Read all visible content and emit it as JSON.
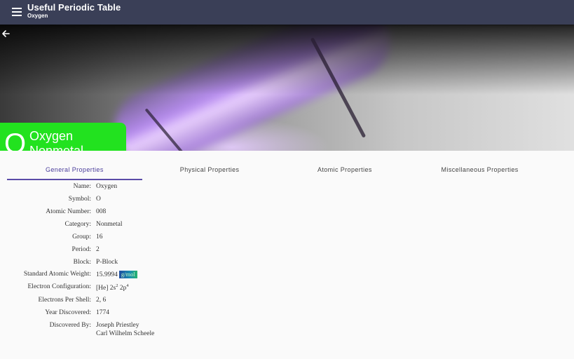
{
  "appbar": {
    "title": "Useful Periodic Table",
    "subtitle": "Oxygen"
  },
  "element": {
    "symbol": "O",
    "name": "Oxygen",
    "category": "Nonmetal",
    "badge_color": "#22e21f"
  },
  "icons": {
    "menu": "menu-icon",
    "back": "arrow-left-icon"
  },
  "tabs": [
    {
      "label": "General Properties",
      "active": true
    },
    {
      "label": "Physical Properties",
      "active": false
    },
    {
      "label": "Atomic Properties",
      "active": false
    },
    {
      "label": "Miscellaneous Properties",
      "active": false
    }
  ],
  "properties": {
    "name": {
      "label": "Name:",
      "value": "Oxygen"
    },
    "symbol": {
      "label": "Symbol:",
      "value": "O"
    },
    "atomic_number": {
      "label": "Atomic Number:",
      "value": "008"
    },
    "category": {
      "label": "Category:",
      "value": "Nonmetal"
    },
    "group": {
      "label": "Group:",
      "value": "16"
    },
    "period": {
      "label": "Period:",
      "value": "2"
    },
    "block": {
      "label": "Block:",
      "value": "P-Block"
    },
    "weight": {
      "label": "Standard Atomic Weight:",
      "value": "15.9994",
      "unit": "g/mol"
    },
    "config": {
      "label": "Electron Configuration:",
      "base": "[He] 2s",
      "sup1": "2",
      "mid": " 2p",
      "sup2": "4"
    },
    "shells": {
      "label": "Electrons Per Shell:",
      "value": "2, 6"
    },
    "year": {
      "label": "Year Discovered:",
      "value": "1774"
    },
    "discovered_by": {
      "label": "Discovered By:",
      "line1": "Joseph Priestley",
      "line2": "Carl Wilhelm Scheele"
    }
  },
  "colors": {
    "appbar": "#3a3f57",
    "tab_active": "#4a3d9b"
  }
}
